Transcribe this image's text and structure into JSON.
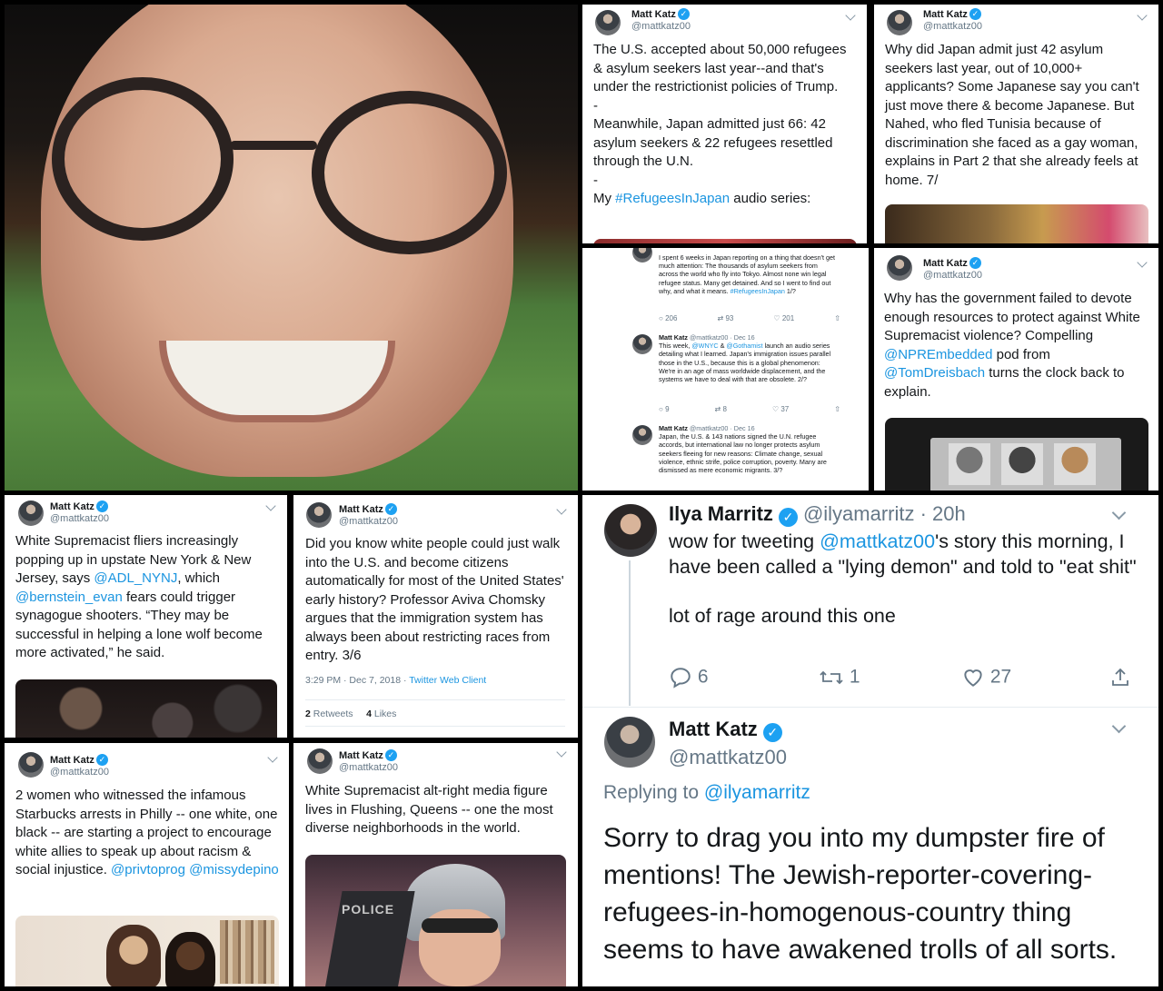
{
  "panels": {
    "photo": {},
    "t1": {
      "name": "Matt Katz",
      "handle": "@mattkatz00",
      "p1": "The U.S. accepted about 50,000 refugees & asylum seekers last year--and that's under the restrictionist policies of Trump.",
      "d1": "-",
      "p2": "Meanwhile, Japan admitted just 66: 42 asylum seekers & 22 refugees resettled through the U.N.",
      "d2": "-",
      "p3a": "My ",
      "p3tag": "#RefugeesInJapan",
      "p3b": " audio series:"
    },
    "t2": {
      "name": "Matt Katz",
      "handle": "@mattkatz00",
      "text": "Why did Japan admit just 42 asylum seekers last year, out of 10,000+ applicants? Some Japanese say you can't just move there & become Japanese. But Nahed, who fled Tunisia because of discrimination she faced as a gay woman, explains in Part 2 that she already feels at home. 7/"
    },
    "thread": {
      "m1": "I spent 6 weeks in Japan reporting on a thing that doesn't get much attention: The thousands of asylum seekers from across the world who fly into Tokyo. Almost none win legal refugee status. Many get detained. And so I went to find out why, and what it means.",
      "m1tag": "#RefugeesInJapan",
      "m1end": " 1/?",
      "m1stats": [
        "206",
        "93",
        "201"
      ],
      "m2name": "Matt Katz",
      "m2handle": "@mattkatz00 · Dec 16",
      "m2a": "This week, ",
      "m2l1": "@WNYC",
      "m2b": " & ",
      "m2l2": "@Gothamist",
      "m2c": " launch an audio series detailing what I learned. Japan's immigration issues parallel those in the U.S., because this is a global phenomenon: We're in an age of mass worldwide displacement, and the systems we have to deal with that are obsolete. 2/?",
      "m2stats": [
        "9",
        "8",
        "37"
      ],
      "m3name": "Matt Katz",
      "m3handle": "@mattkatz00 · Dec 16",
      "m3": "Japan, the U.S. & 143 nations signed the U.N. refugee accords, but international law no longer protects asylum seekers fleeing for new reasons: Climate change, sexual violence, ethnic strife, police corruption, poverty. Many are dismissed as mere economic migrants. 3/?"
    },
    "t3": {
      "name": "Matt Katz",
      "handle": "@mattkatz00",
      "a": "Why has the government failed to devote enough resources to protect against White Supremacist violence? Compelling ",
      "l1": "@NPREmbedded",
      "b": " pod from ",
      "l2": "@TomDreisbach",
      "c": " turns the clock back to explain."
    },
    "t4": {
      "name": "Matt Katz",
      "handle": "@mattkatz00",
      "a": "White Supremacist fliers increasingly popping up in upstate New York & New Jersey, says ",
      "l1": "@ADL_NYNJ",
      "b": ", which ",
      "l2": "@bernstein_evan",
      "c": " fears could trigger synagogue shooters. “They may be successful in helping a lone wolf become more activated,” he said."
    },
    "t5": {
      "name": "Matt Katz",
      "handle": "@mattkatz00",
      "text": "Did you know white people could just walk into the U.S. and become citizens automatically for most of the United States' early history? Professor Aviva Chomsky argues that the immigration system has always been about restricting races from entry. 3/6",
      "time": "3:29 PM · Dec 7, 2018 · ",
      "client": "Twitter Web Client",
      "rt_count": "2",
      "rt_label": " Retweets",
      "like_count": "4",
      "like_label": " Likes"
    },
    "t6": {
      "name": "Ilya Marritz",
      "handle": "@ilyamarritz · 20h",
      "a": "wow for tweeting ",
      "l1": "@mattkatz00",
      "b": "'s story this morning, I have been called a \"lying demon\" and told to \"eat shit\"",
      "c": "lot of rage around this one",
      "replies": "6",
      "retweets": "1",
      "likes": "27",
      "name2": "Matt Katz",
      "handle2": "@mattkatz00",
      "replying": "Replying to ",
      "replying_to": "@ilyamarritz",
      "reply": "Sorry to drag you into my dumpster fire of mentions! The Jewish-reporter-covering-refugees-in-homogenous-country thing seems to have awakened trolls of all sorts."
    },
    "t7": {
      "name": "Matt Katz",
      "handle": "@mattkatz00",
      "a": "2 women who witnessed the infamous Starbucks arrests in Philly -- one white, one black -- are starting a project to encourage white allies to speak up about racism & social injustice. ",
      "l1": "@privtoprog",
      "l2": "@missydepino"
    },
    "t8": {
      "name": "Matt Katz",
      "handle": "@mattkatz00",
      "text": "White Supremacist alt-right media figure lives in Flushing, Queens -- one the most diverse neighborhoods in the world.",
      "photo_sign": "POLICE"
    }
  },
  "colors": {
    "link": "#1b95e0",
    "verified": "#1da1f2",
    "muted": "#657786"
  }
}
